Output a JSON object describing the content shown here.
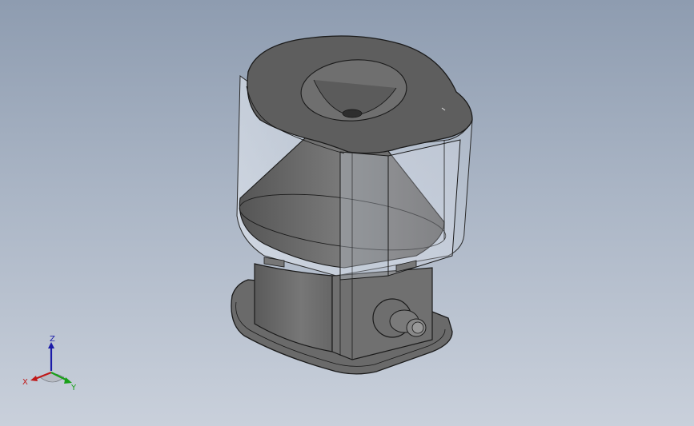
{
  "viewport": {
    "background_top": "#8e9cb0",
    "background_bottom": "#c9d0db"
  },
  "model": {
    "name": "gumball-dispenser-assembly",
    "body_color": "#6d6d6d",
    "glass_color": "#dde4ee",
    "edge_color": "#1a1a1a"
  },
  "triad": {
    "z_label": "Z",
    "x_label": "X",
    "y_label": "Y",
    "z_color": "#1a1aa8",
    "x_color": "#c01818",
    "y_color": "#18a018"
  }
}
